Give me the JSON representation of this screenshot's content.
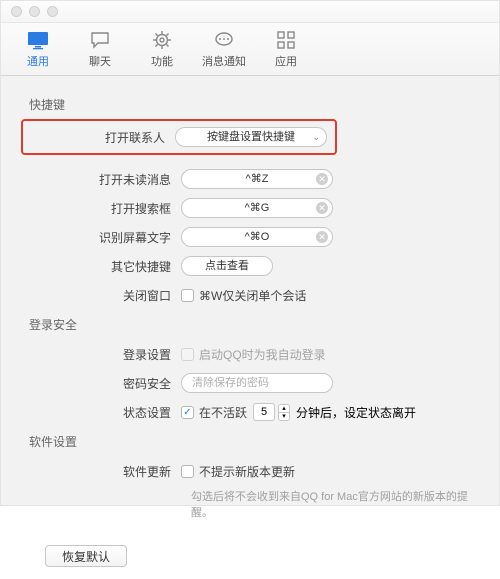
{
  "tabs": {
    "general": "通用",
    "chat": "聊天",
    "function": "功能",
    "notify": "消息通知",
    "app": "应用"
  },
  "sections": {
    "shortcuts": "快捷键",
    "login": "登录安全",
    "software": "软件设置"
  },
  "shortcuts": {
    "open_contacts_label": "打开联系人",
    "open_contacts_value": "按键盘设置快捷键",
    "open_unread_label": "打开未读消息",
    "open_unread_value": "^⌘Z",
    "open_search_label": "打开搜索框",
    "open_search_value": "^⌘G",
    "ocr_label": "识别屏幕文字",
    "ocr_value": "^⌘O",
    "other_label": "其它快捷键",
    "other_value": "点击查看",
    "close_window_label": "关闭窗口",
    "close_window_chk": "⌘W仅关闭单个会话"
  },
  "login": {
    "login_setting_label": "登录设置",
    "login_setting_chk": "启动QQ时为我自动登录",
    "pwd_label": "密码安全",
    "pwd_placeholder": "清除保存的密码",
    "status_label": "状态设置",
    "status_pre": "在不活跃",
    "status_value": "5",
    "status_post": "分钟后，设定状态离开"
  },
  "software": {
    "update_label": "软件更新",
    "update_chk": "不提示新版本更新",
    "update_desc": "勾选后将不会收到来自QQ for Mac官方网站的新版本的提醒。"
  },
  "footer": {
    "restore": "恢复默认"
  }
}
